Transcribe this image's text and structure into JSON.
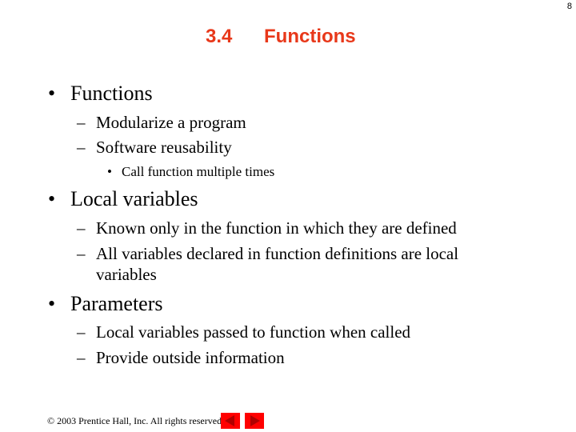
{
  "slide": {
    "page_number": "8",
    "section_number": "3.4",
    "title": "Functions",
    "bullets": [
      {
        "text": "Functions",
        "subitems": [
          {
            "text": "Modularize a program"
          },
          {
            "text": "Software reusability",
            "subitems": [
              {
                "text": "Call function multiple times"
              }
            ]
          }
        ]
      },
      {
        "text": "Local variables",
        "subitems": [
          {
            "text": "Known only in the function in which they are defined"
          },
          {
            "text": "All variables declared in function definitions are local",
            "continuation": "variables"
          }
        ]
      },
      {
        "text": "Parameters",
        "subitems": [
          {
            "text": "Local variables passed to function when called"
          },
          {
            "text": "Provide outside information"
          }
        ]
      }
    ],
    "bullet_glyph": "•",
    "dash_glyph": "–"
  },
  "footer": {
    "copyright": "© 2003 Prentice Hall, Inc.  All rights reserved."
  },
  "nav": {
    "prev_icon": "arrow-left-icon",
    "next_icon": "arrow-right-icon"
  },
  "colors": {
    "title": "#e8381a",
    "nav_button": "#ff0000",
    "nav_arrow": "#b00000"
  }
}
